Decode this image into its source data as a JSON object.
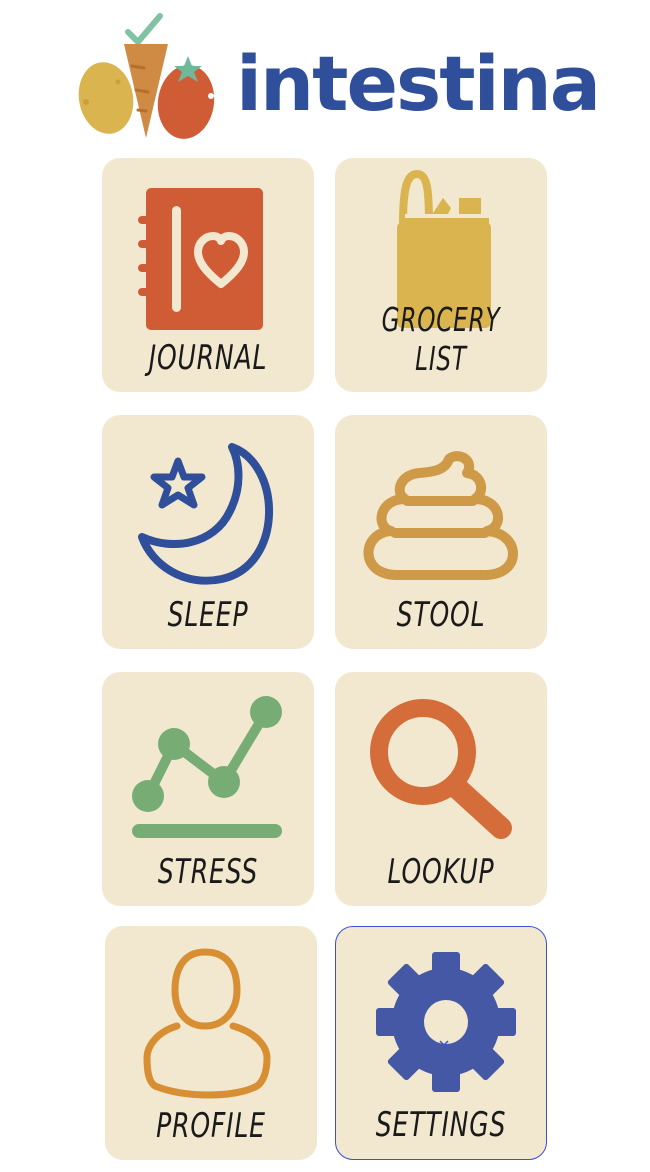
{
  "app": {
    "logo_text": "intestina"
  },
  "tiles": [
    {
      "label": "JOURNAL"
    },
    {
      "label": "GROCERY LIST"
    },
    {
      "label": "SLEEP"
    },
    {
      "label": "STOOL"
    },
    {
      "label": "STRESS"
    },
    {
      "label": "LOOKUP"
    },
    {
      "label": "PROFILE"
    },
    {
      "label": "SETTINGS"
    }
  ],
  "colors": {
    "brand": "#2f4f9a",
    "tile_bg": "#f2e8d0",
    "journal": "#d05c35",
    "grocery": "#d9b44f",
    "sleep": "#2f4f9a",
    "stool": "#cf9a48",
    "stress": "#77ad74",
    "lookup": "#d46d3a",
    "profile": "#d88e32",
    "settings": "#4558a6",
    "selection": "#3b4fd8"
  },
  "icons": [
    "book-heart-icon",
    "grocery-bag-icon",
    "moon-star-icon",
    "stool-icon",
    "trend-chart-icon",
    "magnifier-icon",
    "person-icon",
    "gear-icon"
  ]
}
